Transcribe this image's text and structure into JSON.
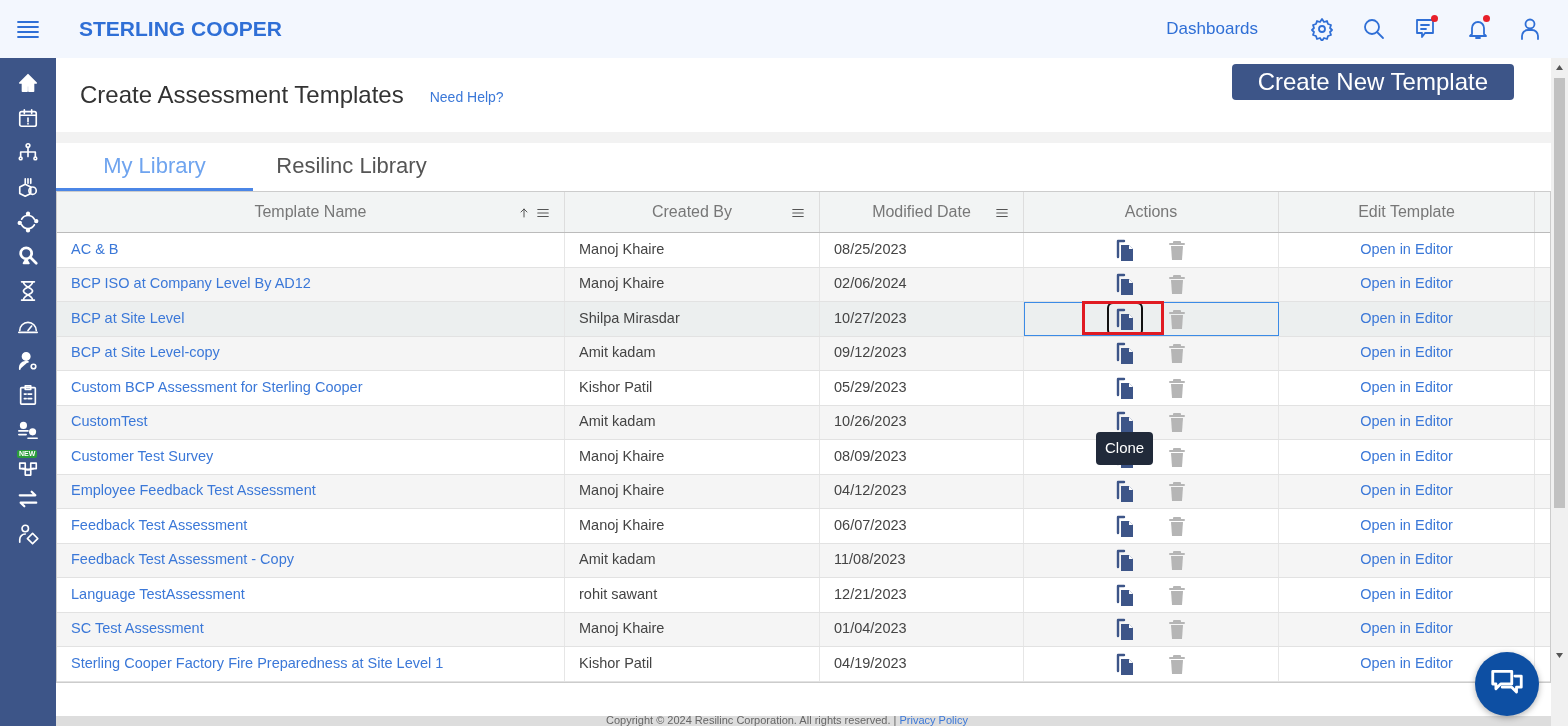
{
  "brand": "STERLING COOPER",
  "topnav": {
    "link": "Dashboards",
    "icons": [
      {
        "kind": "settings",
        "unread": false
      },
      {
        "kind": "search",
        "unread": false
      },
      {
        "kind": "messages",
        "unread": true
      },
      {
        "kind": "bell",
        "unread": true
      },
      {
        "kind": "user",
        "unread": false
      }
    ]
  },
  "sidebar": {
    "items": [
      {
        "kind": "home"
      },
      {
        "kind": "calendar"
      },
      {
        "kind": "hierarchy"
      },
      {
        "kind": "coins"
      },
      {
        "kind": "cycle"
      },
      {
        "kind": "magnifier"
      },
      {
        "kind": "hourglass"
      },
      {
        "kind": "gauge"
      },
      {
        "kind": "user-gear"
      },
      {
        "kind": "clipboard"
      },
      {
        "kind": "people"
      },
      {
        "kind": "network",
        "badge": "NEW"
      },
      {
        "kind": "swap"
      },
      {
        "kind": "user-tag"
      }
    ]
  },
  "page": {
    "title": "Create Assessment Templates",
    "help_link": "Need Help?",
    "create_button": "Create New Template"
  },
  "tabs": [
    {
      "label": "My Library",
      "selected": true
    },
    {
      "label": "Resilinc Library",
      "selected": false
    }
  ],
  "table": {
    "columns": [
      {
        "label": "Template Name",
        "sorted_ascending": true,
        "menu": true
      },
      {
        "label": "Created By",
        "menu": true
      },
      {
        "label": "Modified Date",
        "menu": true
      },
      {
        "label": "Actions",
        "menu": false
      },
      {
        "label": "Edit Template",
        "menu": false
      }
    ],
    "rows": [
      {
        "name": "AC & B",
        "created_by": "Manoj Khaire",
        "modified": "08/25/2023",
        "edit": "Open in Editor",
        "selected": false
      },
      {
        "name": "BCP ISO at Company Level By AD12",
        "created_by": "Manoj Khaire",
        "modified": "02/06/2024",
        "edit": "Open in Editor",
        "selected": false
      },
      {
        "name": "BCP at Site Level",
        "created_by": "Shilpa Mirasdar",
        "modified": "10/27/2023",
        "edit": "Open in Editor",
        "selected": true
      },
      {
        "name": "BCP at Site Level-copy",
        "created_by": "Amit kadam",
        "modified": "09/12/2023",
        "edit": "Open in Editor",
        "selected": false
      },
      {
        "name": "Custom BCP Assessment for Sterling Cooper",
        "created_by": "Kishor Patil",
        "modified": "05/29/2023",
        "edit": "Open in Editor",
        "selected": false
      },
      {
        "name": "CustomTest",
        "created_by": "Amit kadam",
        "modified": "10/26/2023",
        "edit": "Open in Editor",
        "selected": false
      },
      {
        "name": "Customer Test Survey",
        "created_by": "Manoj Khaire",
        "modified": "08/09/2023",
        "edit": "Open in Editor",
        "selected": false
      },
      {
        "name": "Employee Feedback Test Assessment",
        "created_by": "Manoj Khaire",
        "modified": "04/12/2023",
        "edit": "Open in Editor",
        "selected": false
      },
      {
        "name": "Feedback Test Assessment",
        "created_by": "Manoj Khaire",
        "modified": "06/07/2023",
        "edit": "Open in Editor",
        "selected": false
      },
      {
        "name": "Feedback Test Assessment - Copy",
        "created_by": "Amit kadam",
        "modified": "11/08/2023",
        "edit": "Open in Editor",
        "selected": false
      },
      {
        "name": "Language TestAssessment",
        "created_by": "rohit sawant",
        "modified": "12/21/2023",
        "edit": "Open in Editor",
        "selected": false
      },
      {
        "name": "SC Test Assessment",
        "created_by": "Manoj Khaire",
        "modified": "01/04/2023",
        "edit": "Open in Editor",
        "selected": false
      },
      {
        "name": "Sterling Cooper Factory Fire Preparedness at Site Level 1",
        "created_by": "Kishor Patil",
        "modified": "04/19/2023",
        "edit": "Open in Editor",
        "selected": false
      }
    ]
  },
  "tooltip": "Clone",
  "footer": {
    "text": "Copyright © 2024 Resilinc Corporation. All rights reserved. |",
    "link": "Privacy Policy"
  }
}
